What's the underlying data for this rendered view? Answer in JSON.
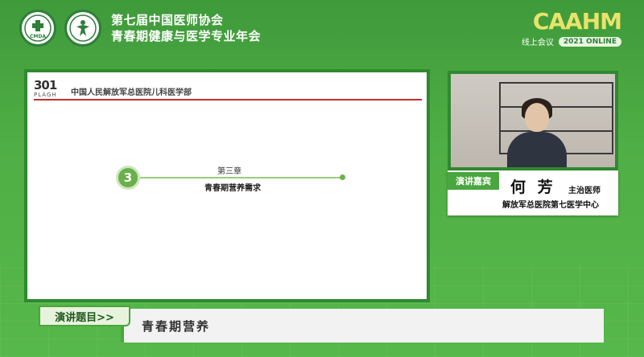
{
  "header": {
    "title_line1": "第七届中国医师协会",
    "title_line2": "青春期健康与医学专业年会",
    "logo1_icon": "cmda-logo-icon",
    "logo1_text": "CMDA",
    "logo2_icon": "association-logo-icon"
  },
  "brand": {
    "logo_text": "CAAHM",
    "subtitle": "线上会议",
    "edition": "2021 ONLINE"
  },
  "slide": {
    "logo_number": "301",
    "logo_text": "PLAGH",
    "org": "中国人民解放军总医院儿科医学部",
    "chapter_badge": "3",
    "chapter_num": "第三章",
    "chapter_title": "青春期营养需求"
  },
  "speaker": {
    "tag": "演讲嘉宾",
    "name": "何 芳",
    "role": "主治医师",
    "org": "解放军总医院第七医学中心"
  },
  "topic": {
    "label": "演讲题目>>",
    "title": "青春期营养"
  },
  "colors": {
    "primary_green": "#4aa63f",
    "dark_green": "#2f8a2f",
    "accent_red": "#c03030",
    "brand_yellow": "#e8e36a"
  }
}
